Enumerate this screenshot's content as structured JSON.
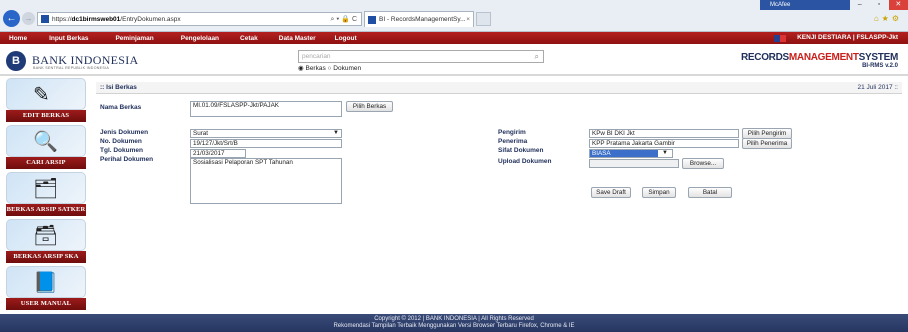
{
  "browser": {
    "url_prefix": "https://",
    "url_domain": "dc1birmsweb01",
    "url_path": "/EntryDokumen.aspx",
    "url_controls": "⌕ ▾ 🔒 C",
    "tab_title": "BI - RecordsManagementSy...",
    "mcafee": "McAfee"
  },
  "menubar": {
    "items": [
      "Home",
      "Input Berkas",
      "Peminjaman",
      "Pengelolaan",
      "Cetak",
      "Data Master",
      "Logout"
    ],
    "user": "KENJI DESTIARA | FSLASPP-Jkt"
  },
  "header": {
    "logo_letter": "B",
    "bank_name": "BANK INDONESIA",
    "bank_subtitle": "BANK SENTRAL REPUBLIK INDONESIA",
    "search_placeholder": "pencarian",
    "radio_berkas": "Berkas",
    "radio_dokumen": "Dokumen",
    "rms_records": "RECORDS",
    "rms_mgmt": "MANAGEMENT",
    "rms_system": "SYSTEM",
    "rms_version": "BI-RMS v.2.0"
  },
  "sidebar": {
    "items": [
      {
        "label": "EDIT BERKAS",
        "icon": "✎"
      },
      {
        "label": "CARI ARSIP",
        "icon": "🔍"
      },
      {
        "label": "BERKAS ARSIP SATKER",
        "icon": "🗂"
      },
      {
        "label": "BERKAS ARSIP SKA",
        "icon": "🗃"
      },
      {
        "label": "USER MANUAL",
        "icon": "📘"
      }
    ]
  },
  "panel": {
    "title": ":: Isi Berkas",
    "date": "21 Juli 2017 ::"
  },
  "form": {
    "nama_berkas_label": "Nama Berkas",
    "nama_berkas_value": "MI.01.09/FSLASPP-Jkt/PAJAK",
    "pilih_berkas": "Pilih Berkas",
    "jenis_dokumen_label": "Jenis Dokumen",
    "jenis_dokumen_value": "Surat",
    "no_dokumen_label": "No. Dokumen",
    "no_dokumen_value": "19/127/Jkt/Srt/B",
    "tgl_dokumen_label": "Tgl. Dokumen",
    "tgl_dokumen_value": "21/03/2017",
    "perihal_label": "Perihal Dokumen",
    "perihal_value": "Sosialisasi Pelaporan SPT Tahunan",
    "pengirim_label": "Pengirim",
    "pengirim_value": "KPw BI DKI Jkt",
    "pilih_pengirim": "Pilih Pengirim",
    "penerima_label": "Penerima",
    "penerima_value": "KPP Pratama Jakarta Gambir",
    "pilih_penerima": "Pilih Penerima",
    "sifat_label": "Sifat Dokumen",
    "sifat_value": "BIASA",
    "upload_label": "Upload Dokumen",
    "browse": "Browse...",
    "save_draft": "Save Draft",
    "simpan": "Simpan",
    "batal": "Batal"
  },
  "footer": {
    "line1": "Copyright © 2012 | BANK INDONESIA | All Rights Reserved",
    "line2": "Rekomendasi Tampilan Terbaik Menggunakan Versi Browser Terbaru Firefox, Chrome & IE"
  }
}
